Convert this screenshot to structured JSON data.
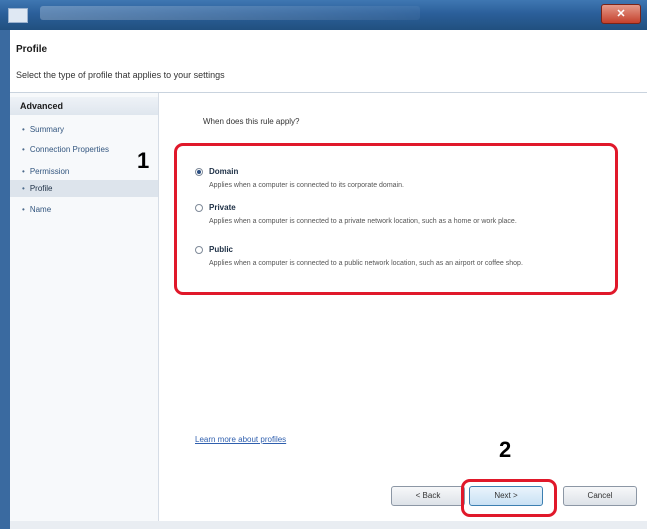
{
  "window": {
    "title": "",
    "close_glyph": "✕"
  },
  "header": {
    "title": "Profile",
    "subtitle": "Select the type of profile that applies to your settings"
  },
  "sidebar": {
    "heading": "Advanced",
    "items": [
      {
        "label": "Summary"
      },
      {
        "label": "Connection Properties"
      },
      {
        "label": "Permission"
      },
      {
        "label": "Profile"
      },
      {
        "label": "Name"
      }
    ]
  },
  "main": {
    "question": "When does this rule apply?",
    "options": [
      {
        "label": "Domain",
        "desc": "Applies when a computer is connected to its corporate domain.",
        "checked": true
      },
      {
        "label": "Private",
        "desc": "Applies when a computer is connected to a private network location, such as a home or work place.",
        "checked": false
      },
      {
        "label": "Public",
        "desc": "Applies when a computer is connected to a public network location, such as an airport or coffee shop.",
        "checked": false
      }
    ],
    "link": "Learn more about profiles"
  },
  "buttons": {
    "back": "< Back",
    "next": "Next >",
    "cancel": "Cancel"
  },
  "callouts": {
    "one": "1",
    "two": "2"
  },
  "colors": {
    "highlight": "#e0182a",
    "titlebar": "#2b5f9a",
    "close": "#c4412c"
  }
}
